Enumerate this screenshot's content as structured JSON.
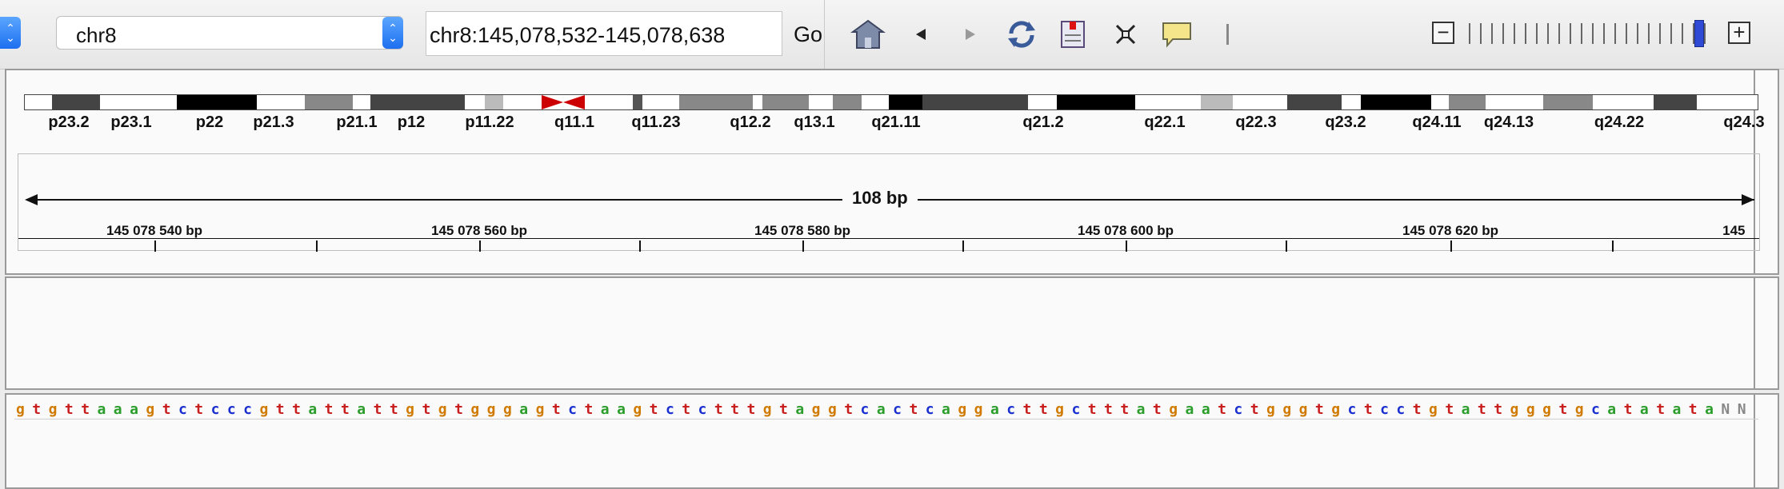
{
  "toolbar": {
    "chromosome": "chr8",
    "locus": "chr8:145,078,532-145,078,638",
    "go_label": "Go"
  },
  "ideogram": {
    "bands": [
      {
        "label": "p23.2"
      },
      {
        "label": "p23.1"
      },
      {
        "label": "p22"
      },
      {
        "label": "p21.3"
      },
      {
        "label": "p21.1"
      },
      {
        "label": "p12"
      },
      {
        "label": "p11.22"
      },
      {
        "label": "q11.1"
      },
      {
        "label": "q11.23"
      },
      {
        "label": "q12.2"
      },
      {
        "label": "q13.1"
      },
      {
        "label": "q21.11"
      },
      {
        "label": "q21.2"
      },
      {
        "label": "q22.1"
      },
      {
        "label": "q22.3"
      },
      {
        "label": "q23.2"
      },
      {
        "label": "q24.11"
      },
      {
        "label": "q24.13"
      },
      {
        "label": "q24.22"
      },
      {
        "label": "q24.3"
      }
    ]
  },
  "ruler": {
    "span_label": "108 bp",
    "ticks": [
      "145 078 540 bp",
      "145 078 560 bp",
      "145 078 580 bp",
      "145 078 600 bp",
      "145 078 620 bp",
      "145"
    ]
  },
  "sequence": {
    "bases": "gtgttaaagtctcccgttattattgtgtgggagtctaagtctctttgtaggtcactcaggacttgctttatgaatctgggtgctcctgtattgggtgcatatataNN"
  },
  "colors": {
    "a": "#2a9d2a",
    "c": "#1a2fcf",
    "g": "#d07a00",
    "t": "#c81e1e",
    "n": "#888888"
  }
}
